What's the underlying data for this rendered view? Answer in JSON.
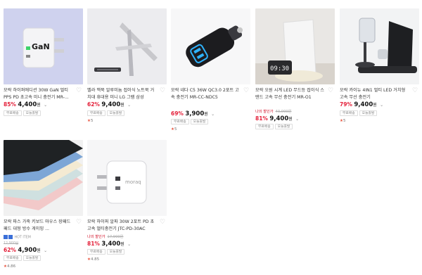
{
  "products": [
    {
      "title": "모락 하이퍼에디션 30W GaN 멀티 PPS PD 초고속 미니 충전기 MR-...",
      "deal_label": "",
      "original_price": "",
      "discount": "85%",
      "price": "4,400",
      "currency": "원",
      "tags": [
        "무료배송",
        "오늘출발"
      ],
      "rating": "",
      "reviews": "",
      "badge": "",
      "sub_note": "",
      "thumb_icon": "gan-charger-image",
      "thumb_text": "GaN"
    },
    {
      "title": "벨라 맥북 알루미늄 접이식 노트북 거치대 휴대용 미니 LG 그램 삼성",
      "deal_label": "",
      "original_price": "",
      "discount": "62%",
      "price": "9,400",
      "currency": "원",
      "tags": [
        "무료배송",
        "오늘출발"
      ],
      "rating": "5",
      "reviews": "",
      "badge": "",
      "sub_note": "",
      "thumb_icon": "laptop-stand-image",
      "thumb_text": ""
    },
    {
      "title": "모락 네다 C5 36W QC3.0 2포트 고속 충전기 MR-CC-NDC5",
      "deal_label": "",
      "original_price": "",
      "discount": "69%",
      "price": "3,900",
      "currency": "원",
      "tags": [
        "무료배송",
        "오늘출발"
      ],
      "rating": "5",
      "reviews": "",
      "badge": "",
      "sub_note": "",
      "thumb_icon": "car-charger-image",
      "thumb_text": ""
    },
    {
      "title": "모락 오원 시계 LED 무드등 접이식 스탠드 고속 무선 충전기 MR-O1",
      "deal_label": "나의 할인가",
      "original_price": "40,000원",
      "discount": "81%",
      "price": "9,400",
      "currency": "원",
      "tags": [
        "무료배송",
        "오늘출발"
      ],
      "rating": "",
      "reviews": "",
      "badge": "",
      "sub_note": "",
      "thumb_icon": "led-clock-wireless-charger-image",
      "thumb_text": "09:30"
    },
    {
      "title": "모락 카이뉴 4IN1 멀티 LED 거치형 고속 무선 충전기",
      "deal_label": "",
      "original_price": "",
      "discount": "79%",
      "price": "9,400",
      "currency": "원",
      "tags": [
        "무료배송",
        "오늘출발"
      ],
      "rating": "5",
      "reviews": "",
      "badge": "",
      "sub_note": "",
      "thumb_icon": "multi-wireless-charger-image",
      "thumb_text": ""
    },
    {
      "title": "모락 파스 가죽 키보드 마우스 장패드 패드 대형 방수 게이밍 ...",
      "deal_label": "",
      "original_price": "12,900원",
      "discount": "62%",
      "price": "4,900",
      "currency": "원",
      "tags": [
        "무료배송",
        "오늘출발"
      ],
      "rating": "4.86",
      "reviews": "",
      "badge": "HOT ITEM",
      "sub_note": "",
      "thumb_icon": "leather-desk-pad-image",
      "thumb_text": ""
    },
    {
      "title": "모락 하이퍼 알파 30W 2포트 PD 초고속 멀티충전기 JTC-PD-30AC",
      "deal_label": "나의 할인가",
      "original_price": "17,900원",
      "discount": "81%",
      "price": "3,400",
      "currency": "원",
      "tags": [
        "무료배송",
        "오늘출발"
      ],
      "rating": "4.85",
      "reviews": "",
      "badge": "",
      "sub_note": "",
      "thumb_icon": "wall-charger-image",
      "thumb_text": "moraq"
    }
  ]
}
